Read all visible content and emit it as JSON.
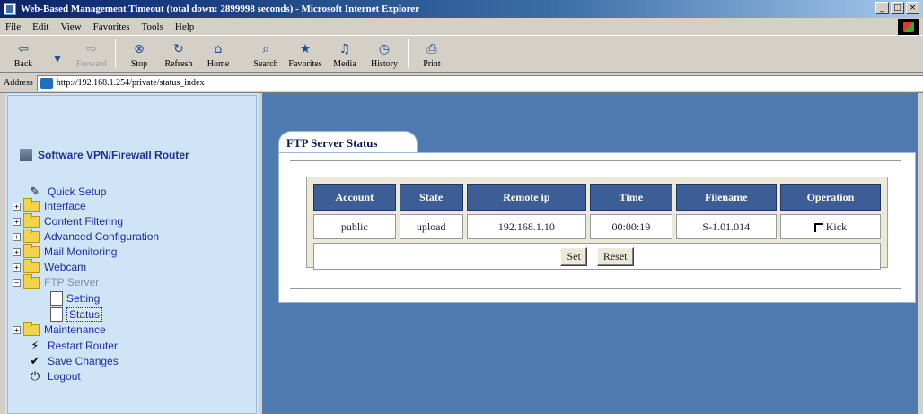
{
  "window": {
    "title": "Web-Based Management Timeout (total down: 2899998 seconds) - Microsoft Internet Explorer",
    "controls": [
      "_",
      "□",
      "×"
    ]
  },
  "menu": [
    "File",
    "Edit",
    "View",
    "Favorites",
    "Tools",
    "Help"
  ],
  "toolbar": [
    {
      "label": "Back",
      "icon": "back-arrow-icon",
      "glyph": "⇦",
      "disabled": false
    },
    {
      "label": "",
      "icon": "dropdown-icon",
      "glyph": "▾",
      "disabled": false
    },
    {
      "label": "Forward",
      "icon": "forward-arrow-icon",
      "glyph": "⇨",
      "disabled": true
    },
    {
      "label": "Stop",
      "icon": "stop-icon",
      "glyph": "⊗",
      "disabled": false
    },
    {
      "label": "Refresh",
      "icon": "refresh-icon",
      "glyph": "↻",
      "disabled": false
    },
    {
      "label": "Home",
      "icon": "home-icon",
      "glyph": "⌂",
      "disabled": false
    },
    {
      "label": "Search",
      "icon": "search-icon",
      "glyph": "⌕",
      "disabled": false
    },
    {
      "label": "Favorites",
      "icon": "favorites-icon",
      "glyph": "★",
      "disabled": false
    },
    {
      "label": "Media",
      "icon": "media-icon",
      "glyph": "♫",
      "disabled": false
    },
    {
      "label": "History",
      "icon": "history-icon",
      "glyph": "◷",
      "disabled": false
    },
    {
      "label": "Print",
      "icon": "print-icon",
      "glyph": "⎙",
      "disabled": false
    }
  ],
  "address": {
    "label": "Address",
    "value": "http://192.168.1.254/private/status_index"
  },
  "sidebar": {
    "root": "Software VPN/Firewall Router",
    "items": [
      {
        "label": "Quick Setup",
        "type": "tool",
        "glyph": "✎"
      },
      {
        "label": "Interface",
        "type": "folder",
        "expand": "+"
      },
      {
        "label": "Content Filtering",
        "type": "folder",
        "expand": "+"
      },
      {
        "label": "Advanced Configuration",
        "type": "folder",
        "expand": "+"
      },
      {
        "label": "Mail Monitoring",
        "type": "folder",
        "expand": "+"
      },
      {
        "label": "Webcam",
        "type": "folder",
        "expand": "+"
      },
      {
        "label": "FTP Server",
        "type": "folder-open",
        "expand": "−"
      },
      {
        "label": "Setting",
        "type": "page"
      },
      {
        "label": "Status",
        "type": "page"
      },
      {
        "label": "Maintenance",
        "type": "folder",
        "expand": "+"
      },
      {
        "label": "Restart Router",
        "type": "tool",
        "glyph": "⚡"
      },
      {
        "label": "Save Changes",
        "type": "tool",
        "glyph": "✔"
      },
      {
        "label": "Logout",
        "type": "tool",
        "glyph": "⏻"
      }
    ]
  },
  "main": {
    "tab_title": "FTP Server Status",
    "columns": [
      "Account",
      "State",
      "Remote ip",
      "Time",
      "Filename",
      "Operation"
    ],
    "rows": [
      {
        "account": "public",
        "state": "upload",
        "remote_ip": "192.168.1.10",
        "time": "00:00:19",
        "filename": "S-1.01.014",
        "operation": "Kick"
      }
    ],
    "set_label": "Set",
    "reset_label": "Reset"
  }
}
